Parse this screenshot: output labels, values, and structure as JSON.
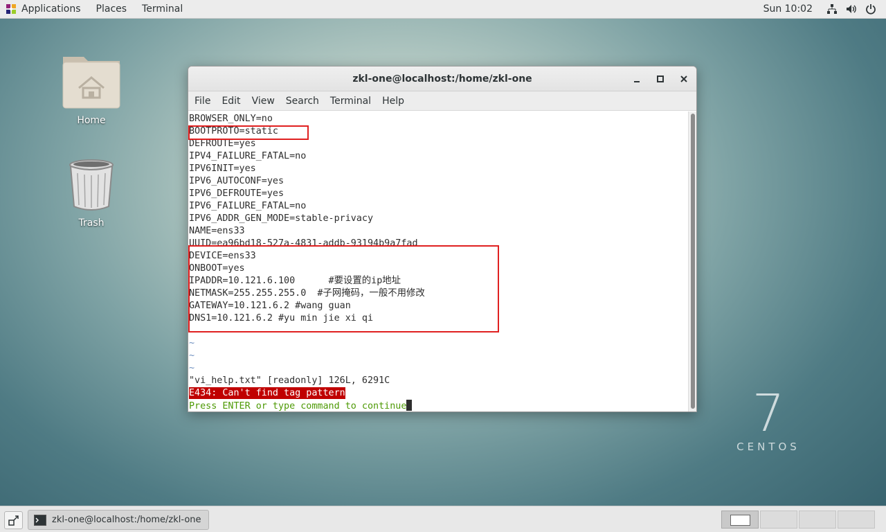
{
  "topbar": {
    "applications": "Applications",
    "places": "Places",
    "terminal": "Terminal",
    "clock": "Sun 10:02"
  },
  "desktop": {
    "icons": [
      {
        "label": "Home",
        "icon": "home-folder-icon"
      },
      {
        "label": "Trash",
        "icon": "trash-icon"
      }
    ],
    "logo_numeral": "7",
    "logo_word": "CENTOS"
  },
  "window": {
    "title": "zkl-one@localhost:/home/zkl-one",
    "menu": [
      "File",
      "Edit",
      "View",
      "Search",
      "Terminal",
      "Help"
    ],
    "lines": [
      "BROWSER_ONLY=no",
      "BOOTPROTO=static",
      "DEFROUTE=yes",
      "IPV4_FAILURE_FATAL=no",
      "IPV6INIT=yes",
      "IPV6_AUTOCONF=yes",
      "IPV6_DEFROUTE=yes",
      "IPV6_FAILURE_FATAL=no",
      "IPV6_ADDR_GEN_MODE=stable-privacy",
      "NAME=ens33",
      "UUID=ea96bd18-527a-4831-addb-93194b9a7fad",
      "DEVICE=ens33",
      "ONBOOT=yes",
      "IPADDR=10.121.6.100      #要设置的ip地址",
      "NETMASK=255.255.255.0  #子网掩码，一般不用修改",
      "GATEWAY=10.121.6.2 #wang guan",
      "DNS1=10.121.6.2 #yu min jie xi qi",
      ""
    ],
    "tildes": [
      "~",
      "~",
      "~"
    ],
    "status_file": "\"vi_help.txt\" [readonly] 126L, 6291C",
    "status_error": "E434: Can't find tag pattern",
    "status_prompt": "Press ENTER or type command to continue"
  },
  "taskbar": {
    "task_label": "zkl-one@localhost:/home/zkl-one",
    "workspaces": 4
  }
}
